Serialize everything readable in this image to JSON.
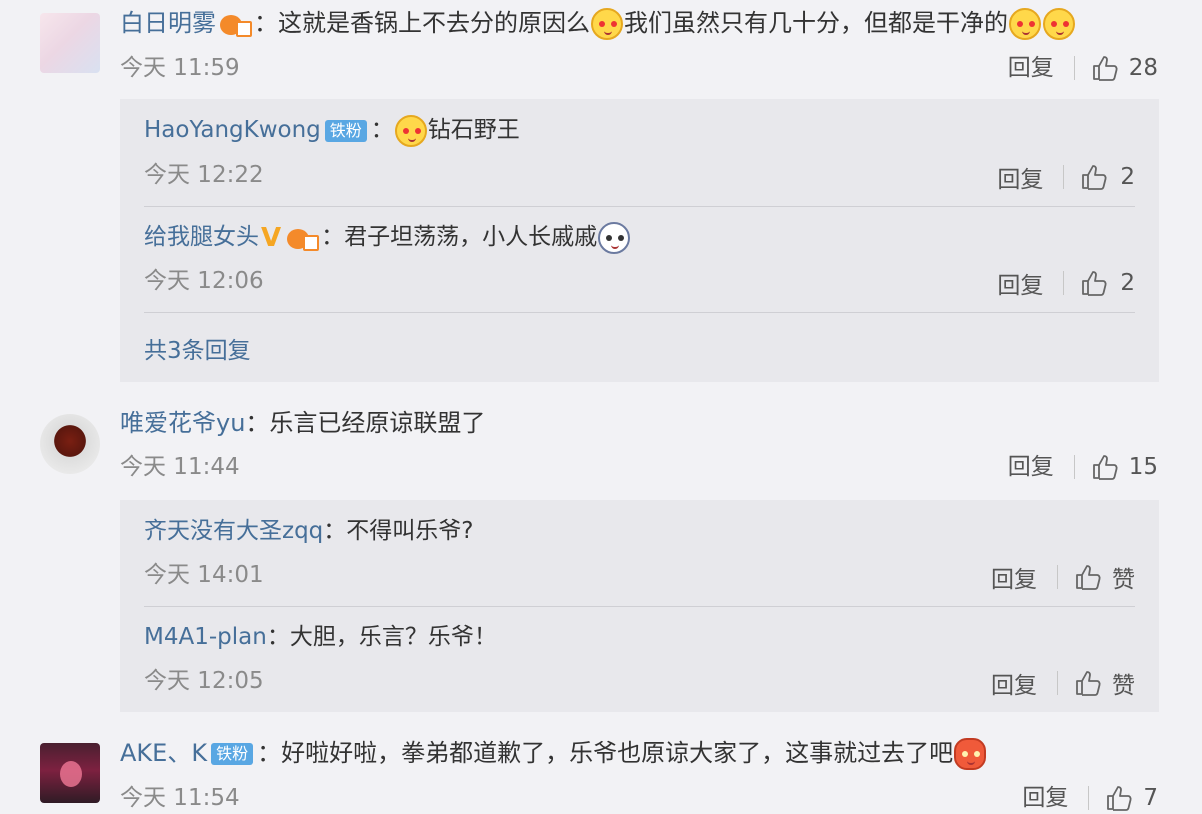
{
  "comments": [
    {
      "user": "白日明雾",
      "colon": "：",
      "text1": "这就是香锅上不去分的原因么",
      "text2": "我们虽然只有几十分，但都是干净的",
      "time": "今天 11:59",
      "reply": "回复",
      "likes": "28",
      "replies": [
        {
          "user": "HaoYangKwong",
          "badge": "铁粉",
          "colon": "：",
          "text": "钻石野王",
          "time": "今天 12:22",
          "reply": "回复",
          "likes": "2"
        },
        {
          "user": "给我腿女头",
          "colon": "：",
          "text": "君子坦荡荡，小人长戚戚",
          "time": "今天 12:06",
          "reply": "回复",
          "likes": "2"
        }
      ],
      "more": "共3条回复"
    },
    {
      "user": "唯爱花爷yu",
      "colon": "：",
      "text": "乐言已经原谅联盟了",
      "time": "今天 11:44",
      "reply": "回复",
      "likes": "15",
      "replies": [
        {
          "user": "齐天没有大圣zqq",
          "colon": "：",
          "text": "不得叫乐爷?",
          "time": "今天 14:01",
          "reply": "回复",
          "likes": "赞"
        },
        {
          "user": "M4A1-plan",
          "colon": "：",
          "text": "大胆，乐言？乐爷！",
          "time": "今天 12:05",
          "reply": "回复",
          "likes": "赞"
        }
      ]
    },
    {
      "user": "AKE、K",
      "badge": "铁粉",
      "colon": "：",
      "text": "好啦好啦，拳弟都道歉了，乐爷也原谅大家了，这事就过去了吧",
      "time": "今天 11:54",
      "reply": "回复",
      "likes": "7"
    }
  ],
  "icons": {
    "thumb": "thumbs-up-icon",
    "vip": "vip-icon",
    "verified": "verified-icon",
    "emoji_cat": "cat-emoji-icon",
    "emoji_panda": "panda-emoji-icon",
    "emoji_lantern": "lantern-emoji-icon"
  },
  "colors": {
    "username": "#466f99",
    "background": "#f2f2f5",
    "panel": "#e8e8ec",
    "badge": "#59a7e3"
  }
}
